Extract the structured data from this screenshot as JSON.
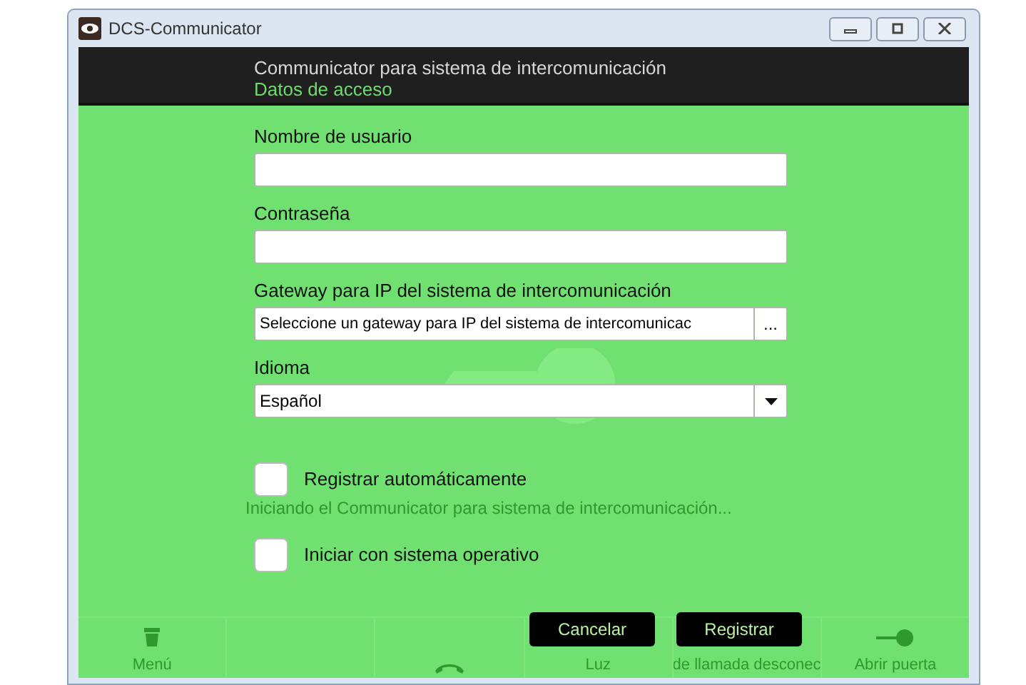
{
  "window": {
    "title": "DCS-Communicator"
  },
  "header": {
    "title": "Communicator para sistema de intercomunicación",
    "subtitle": "Datos de acceso"
  },
  "form": {
    "fields": [
      {
        "kind": "text",
        "label": "Nombre de usuario"
      },
      {
        "kind": "password",
        "label": "Contraseña"
      },
      {
        "kind": "browse",
        "label": "Gateway para IP del sistema de intercomunicación",
        "value": "Seleccione un gateway para IP del sistema de intercomunicac",
        "button": "..."
      },
      {
        "kind": "select",
        "label": "Idioma",
        "value": "Español"
      }
    ],
    "checkboxes": [
      {
        "label": "Registrar automáticamente",
        "checked": false
      },
      {
        "label": "Iniciar con sistema operativo",
        "checked": false
      }
    ],
    "status": "Iniciando el Communicator para sistema de intercomunicación..."
  },
  "buttons": [
    {
      "label": "Cancelar"
    },
    {
      "label": "Registrar"
    }
  ],
  "bottom_bar": [
    {
      "kind": "menu",
      "label": "Menú"
    },
    {
      "kind": "empty"
    },
    {
      "kind": "phone"
    },
    {
      "kind": "text",
      "label": "Luz"
    },
    {
      "kind": "text",
      "label": "de llamada desconec"
    },
    {
      "kind": "key",
      "label": "Abrir puerta"
    }
  ]
}
